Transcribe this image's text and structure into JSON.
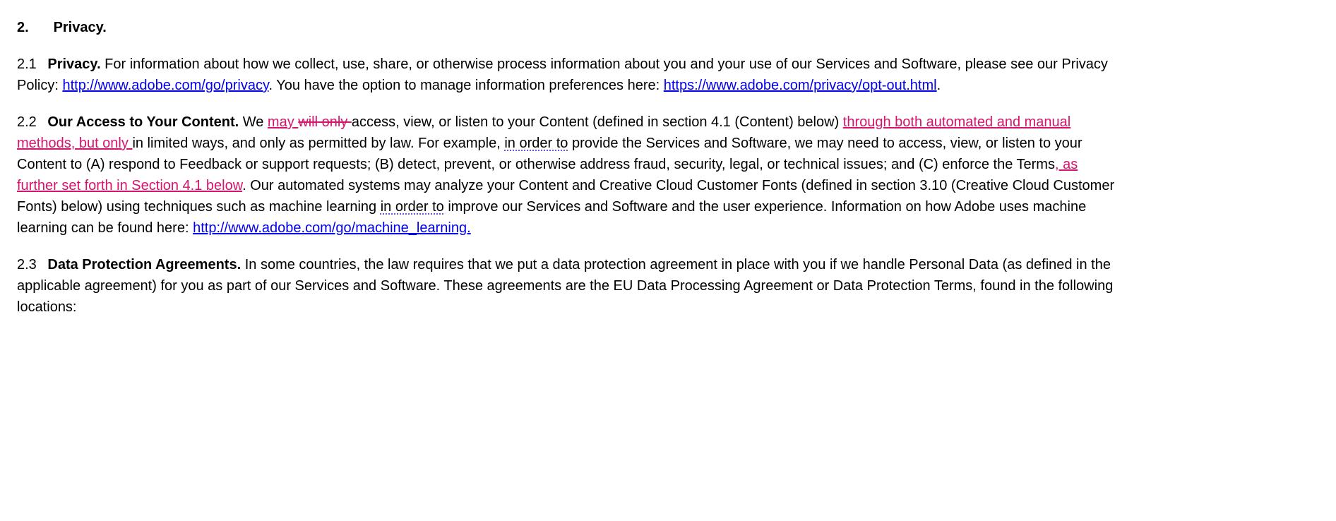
{
  "heading": {
    "number": "2.",
    "title": "Privacy."
  },
  "c21": {
    "num": "2.1",
    "title": "Privacy.",
    "t1": " For information about how we collect, use, share, or otherwise process information about you and your use of our Services and Software, please see our Privacy Policy: ",
    "link1": " http://www.adobe.com/go/privacy",
    "t2": ". You have the option to manage information preferences here: ",
    "link2": "https://www.adobe.com/privacy/opt-out.html",
    "t3": "."
  },
  "c22": {
    "num": "2.2",
    "title": "Our Access to Your Content.",
    "t1": " We ",
    "ins1": "may ",
    "del1": "will only ",
    "t2": "access, view, or listen to your Content (defined in section 4.1 (Content) below) ",
    "ins2": "through both automated and manual methods, but only ",
    "t3": "in limited ways, and only as permitted by law. For example, ",
    "sq1": "in order to",
    "t4": " provide the Services and Software, we may need to access, view, or listen to your Content to (A) respond to Feedback or support requests; (B) detect, prevent, or otherwise address fraud, security, legal, or technical issues; and (C) enforce the Terms",
    "ins3": ", as further set forth in Section 4.1 below",
    "t5": ". Our automated systems may analyze your Content and Creative Cloud Customer Fonts (defined in section 3.10 (Creative Cloud Customer Fonts) below) using techniques such as machine learning ",
    "sq2": "in order to",
    "t6": " improve our Services and Software and the user experience. Information on how Adobe uses machine learning can be found here: ",
    "link1": "http://www.adobe.com/go/machine_learning."
  },
  "c23": {
    "num": "2.3",
    "title": "Data Protection Agreements.",
    "t1": " In some countries, the law requires that we put a data protection agreement in place with you if we handle Personal Data (as defined in the applicable agreement) for you as part of our Services and Software. These agreements are the EU Data Processing Agreement or Data Protection Terms, found in the following locations:"
  }
}
